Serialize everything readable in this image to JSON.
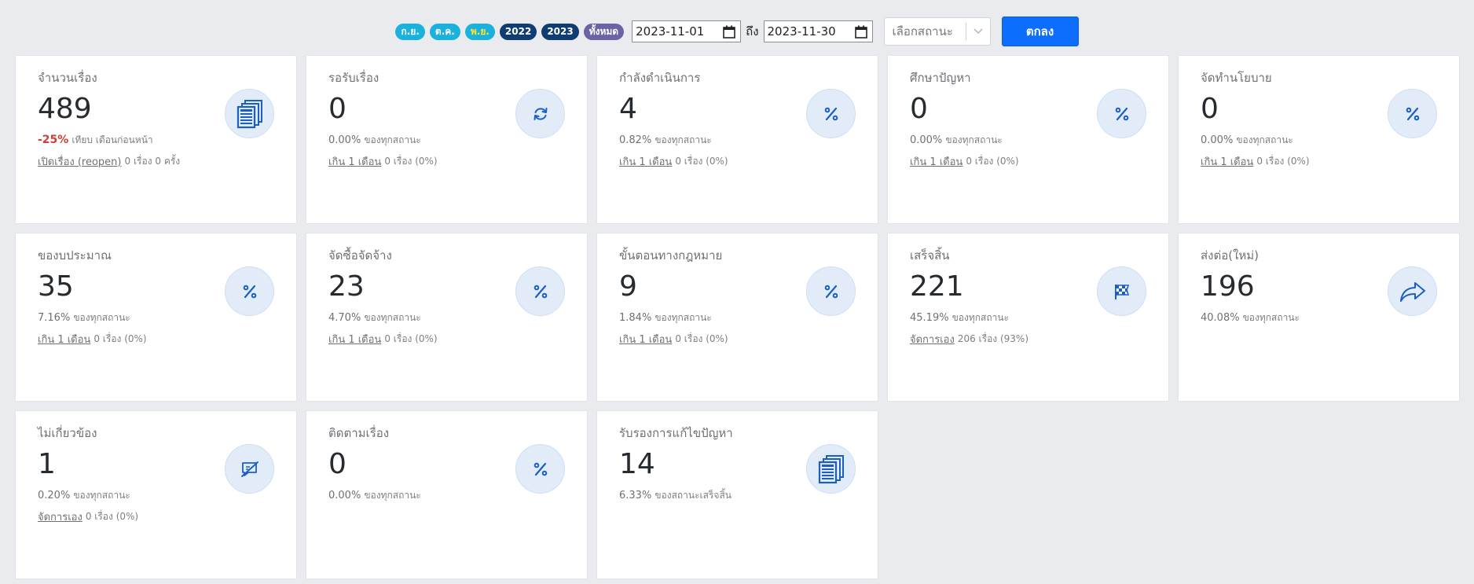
{
  "filters": {
    "chips": [
      {
        "label": "ก.ย.",
        "kind": "month"
      },
      {
        "label": "ต.ค.",
        "kind": "month"
      },
      {
        "label": "พ.ย.",
        "kind": "month-active"
      },
      {
        "label": "2022",
        "kind": "year"
      },
      {
        "label": "2023",
        "kind": "year"
      },
      {
        "label": "ทั้งหมด",
        "kind": "all"
      }
    ],
    "date_from": "2023-11-01",
    "to_label": "ถึง",
    "date_to": "2023-11-30",
    "status_placeholder": "เลือกสถานะ",
    "ok_label": "ตกลง"
  },
  "colors": {
    "accent": "#0d6efd",
    "negative": "#d73a3a",
    "icon": "#1b5fc4",
    "icon_bg": "#e2ecf9"
  },
  "cards": [
    {
      "title": "จำนวนเรื่อง",
      "value": "489",
      "icon": "documents-icon",
      "sub_highlight": "-25%",
      "sub_text": "เทียบ เดือนก่อนหน้า",
      "link_text": "เปิดเรื่อง (reopen)",
      "link_tail": "0 เรื่อง 0 ครั้ง"
    },
    {
      "title": "รอรับเรื่อง",
      "value": "0",
      "icon": "refresh-icon",
      "sub_pct": "0.00%",
      "sub_text": "ของทุกสถานะ",
      "link_text": "เกิน 1 เดือน",
      "link_tail": "0 เรื่อง (0%)"
    },
    {
      "title": "กำลังดำเนินการ",
      "value": "4",
      "icon": "percent-icon",
      "sub_pct": "0.82%",
      "sub_text": "ของทุกสถานะ",
      "link_text": "เกิน 1 เดือน",
      "link_tail": "0 เรื่อง (0%)"
    },
    {
      "title": "ศึกษาปัญหา",
      "value": "0",
      "icon": "percent-icon",
      "sub_pct": "0.00%",
      "sub_text": "ของทุกสถานะ",
      "link_text": "เกิน 1 เดือน",
      "link_tail": "0 เรื่อง (0%)"
    },
    {
      "title": "จัดทำนโยบาย",
      "value": "0",
      "icon": "percent-icon",
      "sub_pct": "0.00%",
      "sub_text": "ของทุกสถานะ",
      "link_text": "เกิน 1 เดือน",
      "link_tail": "0 เรื่อง (0%)"
    },
    {
      "title": "ของบประมาณ",
      "value": "35",
      "icon": "percent-icon",
      "sub_pct": "7.16%",
      "sub_text": "ของทุกสถานะ",
      "link_text": "เกิน 1 เดือน",
      "link_tail": "0 เรื่อง (0%)"
    },
    {
      "title": "จัดซื้อจัดจ้าง",
      "value": "23",
      "icon": "percent-icon",
      "sub_pct": "4.70%",
      "sub_text": "ของทุกสถานะ",
      "link_text": "เกิน 1 เดือน",
      "link_tail": "0 เรื่อง (0%)"
    },
    {
      "title": "ขั้นตอนทางกฎหมาย",
      "value": "9",
      "icon": "percent-icon",
      "sub_pct": "1.84%",
      "sub_text": "ของทุกสถานะ",
      "link_text": "เกิน 1 เดือน",
      "link_tail": "0 เรื่อง (0%)"
    },
    {
      "title": "เสร็จสิ้น",
      "value": "221",
      "icon": "checkered-flag-icon",
      "sub_pct": "45.19%",
      "sub_text": "ของทุกสถานะ",
      "link_text": "จัดการเอง",
      "link_tail": "206 เรื่อง (93%)"
    },
    {
      "title": "ส่งต่อ(ใหม่)",
      "value": "196",
      "icon": "share-icon",
      "sub_pct": "40.08%",
      "sub_text": "ของทุกสถานะ"
    },
    {
      "title": "ไม่เกี่ยวข้อง",
      "value": "1",
      "icon": "comment-slash-icon",
      "sub_pct": "0.20%",
      "sub_text": "ของทุกสถานะ",
      "link_text": "จัดการเอง",
      "link_tail": "0 เรื่อง (0%)"
    },
    {
      "title": "ติดตามเรื่อง",
      "value": "0",
      "icon": "percent-icon",
      "sub_pct": "0.00%",
      "sub_text": "ของทุกสถานะ"
    },
    {
      "title": "รับรองการแก้ไขปัญหา",
      "value": "14",
      "icon": "documents-icon",
      "sub_pct": "6.33%",
      "sub_text": "ของสถานะเสร็จสิ้น"
    }
  ]
}
